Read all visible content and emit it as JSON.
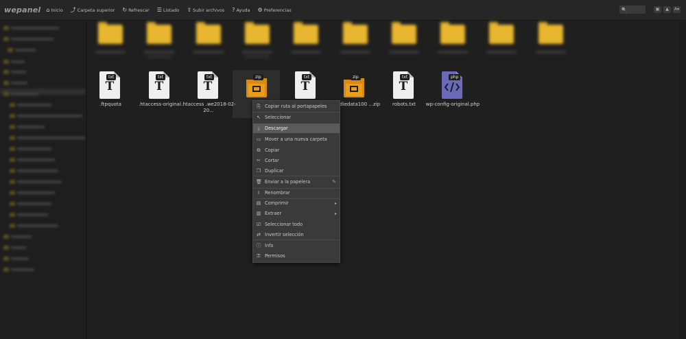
{
  "toolbar": {
    "logo": "wepanel",
    "items": [
      {
        "icon": "home-icon",
        "glyph": "⌂",
        "label": "Inicio"
      },
      {
        "icon": "arrow-up-icon",
        "glyph": "⤴",
        "label": "Carpeta superior"
      },
      {
        "icon": "refresh-icon",
        "glyph": "↻",
        "label": "Refrescar"
      },
      {
        "icon": "list-icon",
        "glyph": "☰",
        "label": "Listado"
      },
      {
        "icon": "upload-icon",
        "glyph": "⇪",
        "label": "Subir archivos"
      },
      {
        "icon": "help-icon",
        "glyph": "?",
        "label": "Ayuda"
      },
      {
        "icon": "settings-icon",
        "glyph": "⚙",
        "label": "Preferencias"
      }
    ],
    "search_icon": "🔍",
    "window_buttons": [
      "▣",
      "▲",
      "A▾"
    ]
  },
  "files": [
    {
      "type": "txt",
      "name": ".ftpquota"
    },
    {
      "type": "txt",
      "name": ".htaccess-original"
    },
    {
      "type": "txt",
      "name": ".htaccess .we2018-02-20..."
    },
    {
      "type": "zip",
      "name": ""
    },
    {
      "type": "txt",
      "name": ""
    },
    {
      "type": "zip",
      "name": "...nodiedata100 ...zip"
    },
    {
      "type": "txt",
      "name": "robots.txt"
    },
    {
      "type": "php",
      "name": "wp-config-original.php"
    }
  ],
  "context_menu": {
    "items": [
      {
        "icon": "copy-path-icon",
        "glyph": "⎘",
        "label": "Copiar ruta al portapapeles"
      },
      {
        "icon": "cursor-icon",
        "glyph": "↖",
        "label": "Seleccionar"
      },
      {
        "icon": "download-icon",
        "glyph": "⤓",
        "label": "Descargar"
      },
      {
        "icon": "move-folder-icon",
        "glyph": "▭",
        "label": "Mover a una nueva carpeta"
      },
      {
        "icon": "copy-icon",
        "glyph": "⧉",
        "label": "Copiar"
      },
      {
        "icon": "cut-icon",
        "glyph": "✂",
        "label": "Cortar"
      },
      {
        "icon": "duplicate-icon",
        "glyph": "❐",
        "label": "Duplicar"
      },
      {
        "icon": "trash-icon",
        "glyph": "🗑",
        "label": "Enviar a la papelera"
      },
      {
        "icon": "rename-icon",
        "glyph": "I",
        "label": "Renombrar"
      },
      {
        "icon": "compress-icon",
        "glyph": "▤",
        "label": "Comprimir"
      },
      {
        "icon": "extract-icon",
        "glyph": "▥",
        "label": "Extraer"
      },
      {
        "icon": "select-all-icon",
        "glyph": "☑",
        "label": "Seleccionar todo"
      },
      {
        "icon": "invert-selection-icon",
        "glyph": "⇄",
        "label": "Invertir selección"
      },
      {
        "icon": "info-icon",
        "glyph": "ⓘ",
        "label": "Info"
      },
      {
        "icon": "permissions-icon",
        "glyph": "⚿",
        "label": "Permisos"
      }
    ]
  },
  "colors": {
    "folder": "#e8b72f",
    "txt": "#efefef",
    "zip": "#d98a12",
    "php": "#6a6ab8",
    "menu_bg": "#3a3a3a",
    "menu_highlight": "#5a5a5a"
  }
}
